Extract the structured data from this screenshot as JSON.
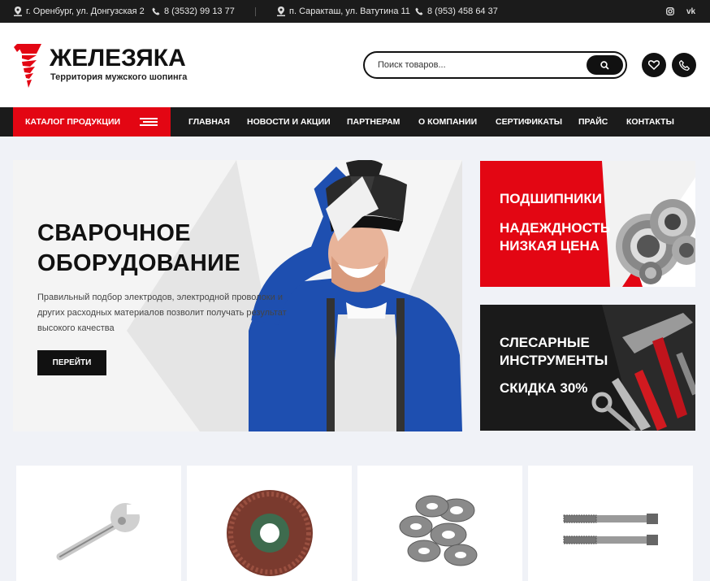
{
  "topbar": {
    "address1": "г. Оренбург, ул. Донгузская 2",
    "phone1": "8 (3532) 99 13 77",
    "address2": "п. Саракташ, ул. Ватутина 11",
    "phone2": "8 (953) 458 64 37",
    "social": [
      {
        "icon": "instagram-icon"
      },
      {
        "icon": "vk-icon",
        "label": "vk"
      }
    ]
  },
  "header": {
    "logo_title": "ЖЕЛЕЗЯКА",
    "logo_subtitle": "Территория мужского шопинга",
    "search_placeholder": "Поиск товаров...",
    "icons": [
      "heart-icon",
      "phone-icon"
    ]
  },
  "nav": {
    "catalog_label": "КАТАЛОГ ПРОДУКЦИИ",
    "items": [
      "ГЛАВНАЯ",
      "НОВОСТИ И АКЦИИ",
      "ПАРТНЕРАМ",
      "О КОМПАНИИ",
      "СЕРТИФИКАТЫ",
      "ПРАЙС",
      "КОНТАКТЫ"
    ]
  },
  "hero": {
    "title": "СВАРОЧНОЕ\nОБОРУДОВАНИЕ",
    "description": "Правильный подбор электродов, электродной проволоки и других расходных материалов позволит получать результат высокого качества",
    "button_label": "ПЕРЕЙТИ"
  },
  "banners": [
    {
      "line1": "ПОДШИПНИКИ",
      "line2": "НАДЕЖДНОСТЬ",
      "line3": "НИЗКАЯ ЦЕНА"
    },
    {
      "line1": "СЛЕСАРНЫЕ",
      "line2": "ИНСТРУМЕНТЫ",
      "line3": "СКИДКА 30%"
    }
  ],
  "products": [
    "adjustable-wrench",
    "flap-disc",
    "washers",
    "taps"
  ],
  "colors": {
    "accent": "#e30613",
    "dark": "#1b1b1b"
  }
}
